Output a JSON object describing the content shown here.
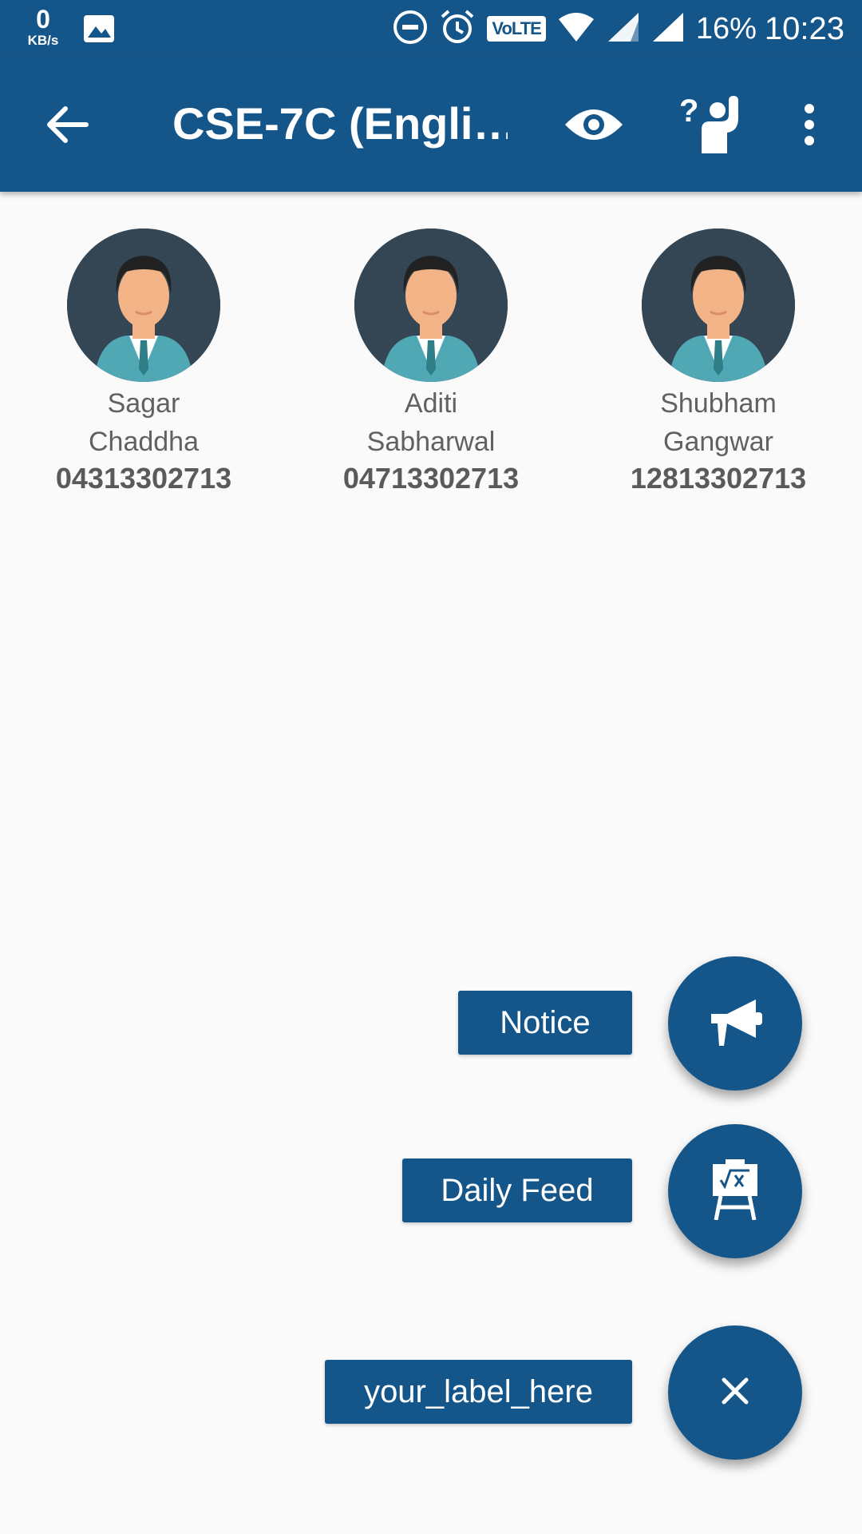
{
  "status_bar": {
    "net_speed_value": "0",
    "net_speed_unit": "KB/s",
    "volte": "VoLTE",
    "battery": "16%",
    "time": "10:23",
    "icons": [
      "gallery-icon",
      "dnd-icon",
      "alarm-icon",
      "volte-icon",
      "wifi-icon",
      "signal-icon",
      "signal-icon"
    ]
  },
  "app_bar": {
    "title": "CSE-7C (Engli…",
    "actions": [
      "back-arrow-icon",
      "eye-icon",
      "raise-hand-question-icon",
      "more-vert-icon"
    ]
  },
  "students": [
    {
      "first": "Sagar",
      "last": "Chaddha",
      "roll": "04313302713"
    },
    {
      "first": "Aditi",
      "last": "Sabharwal",
      "roll": "04713302713"
    },
    {
      "first": "Shubham",
      "last": "Gangwar",
      "roll": "12813302713"
    }
  ],
  "fab_menu": {
    "notice_label": "Notice",
    "daily_feed_label": "Daily Feed",
    "main_label": "your_label_here",
    "icons": [
      "megaphone-icon",
      "blackboard-icon",
      "close-icon"
    ]
  },
  "colors": {
    "primary": "#15568a",
    "background": "#fafafa",
    "avatar_bg": "#344654",
    "text_grey": "#616161"
  }
}
